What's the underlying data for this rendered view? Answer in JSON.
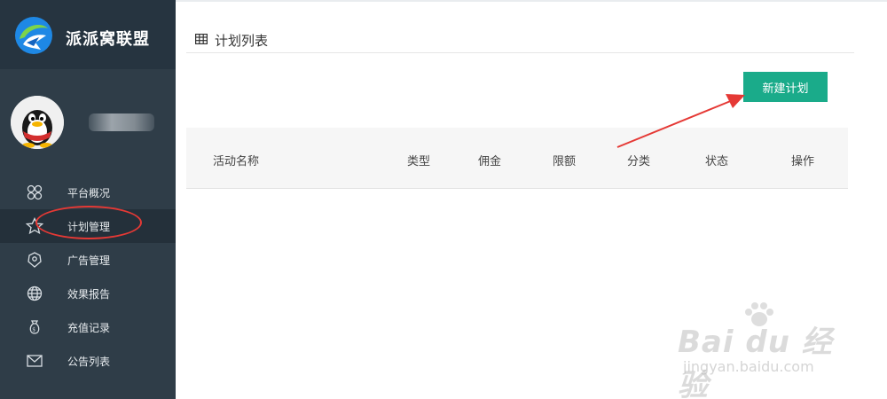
{
  "brand": {
    "title": "派派窝联盟"
  },
  "user": {
    "name": ""
  },
  "sidebar": {
    "items": [
      {
        "label": "平台概况",
        "icon": "clover-icon",
        "active": false
      },
      {
        "label": "计划管理",
        "icon": "star-icon",
        "active": true
      },
      {
        "label": "广告管理",
        "icon": "badge-icon",
        "active": false
      },
      {
        "label": "效果报告",
        "icon": "globe-icon",
        "active": false
      },
      {
        "label": "充值记录",
        "icon": "money-bag-icon",
        "active": false
      },
      {
        "label": "公告列表",
        "icon": "envelope-icon",
        "active": false
      }
    ]
  },
  "main": {
    "title": "计划列表",
    "new_button": "新建计划",
    "columns": [
      "活动名称",
      "类型",
      "佣金",
      "限额",
      "分类",
      "状态",
      "操作"
    ]
  },
  "watermark": {
    "main": "Bai du 经验",
    "sub": "jingyan.baidu.com"
  },
  "colors": {
    "sidebar": "#2f3d48",
    "brand_bar": "#263440",
    "accent": "#1aab8a",
    "annotation": "#e53935"
  }
}
